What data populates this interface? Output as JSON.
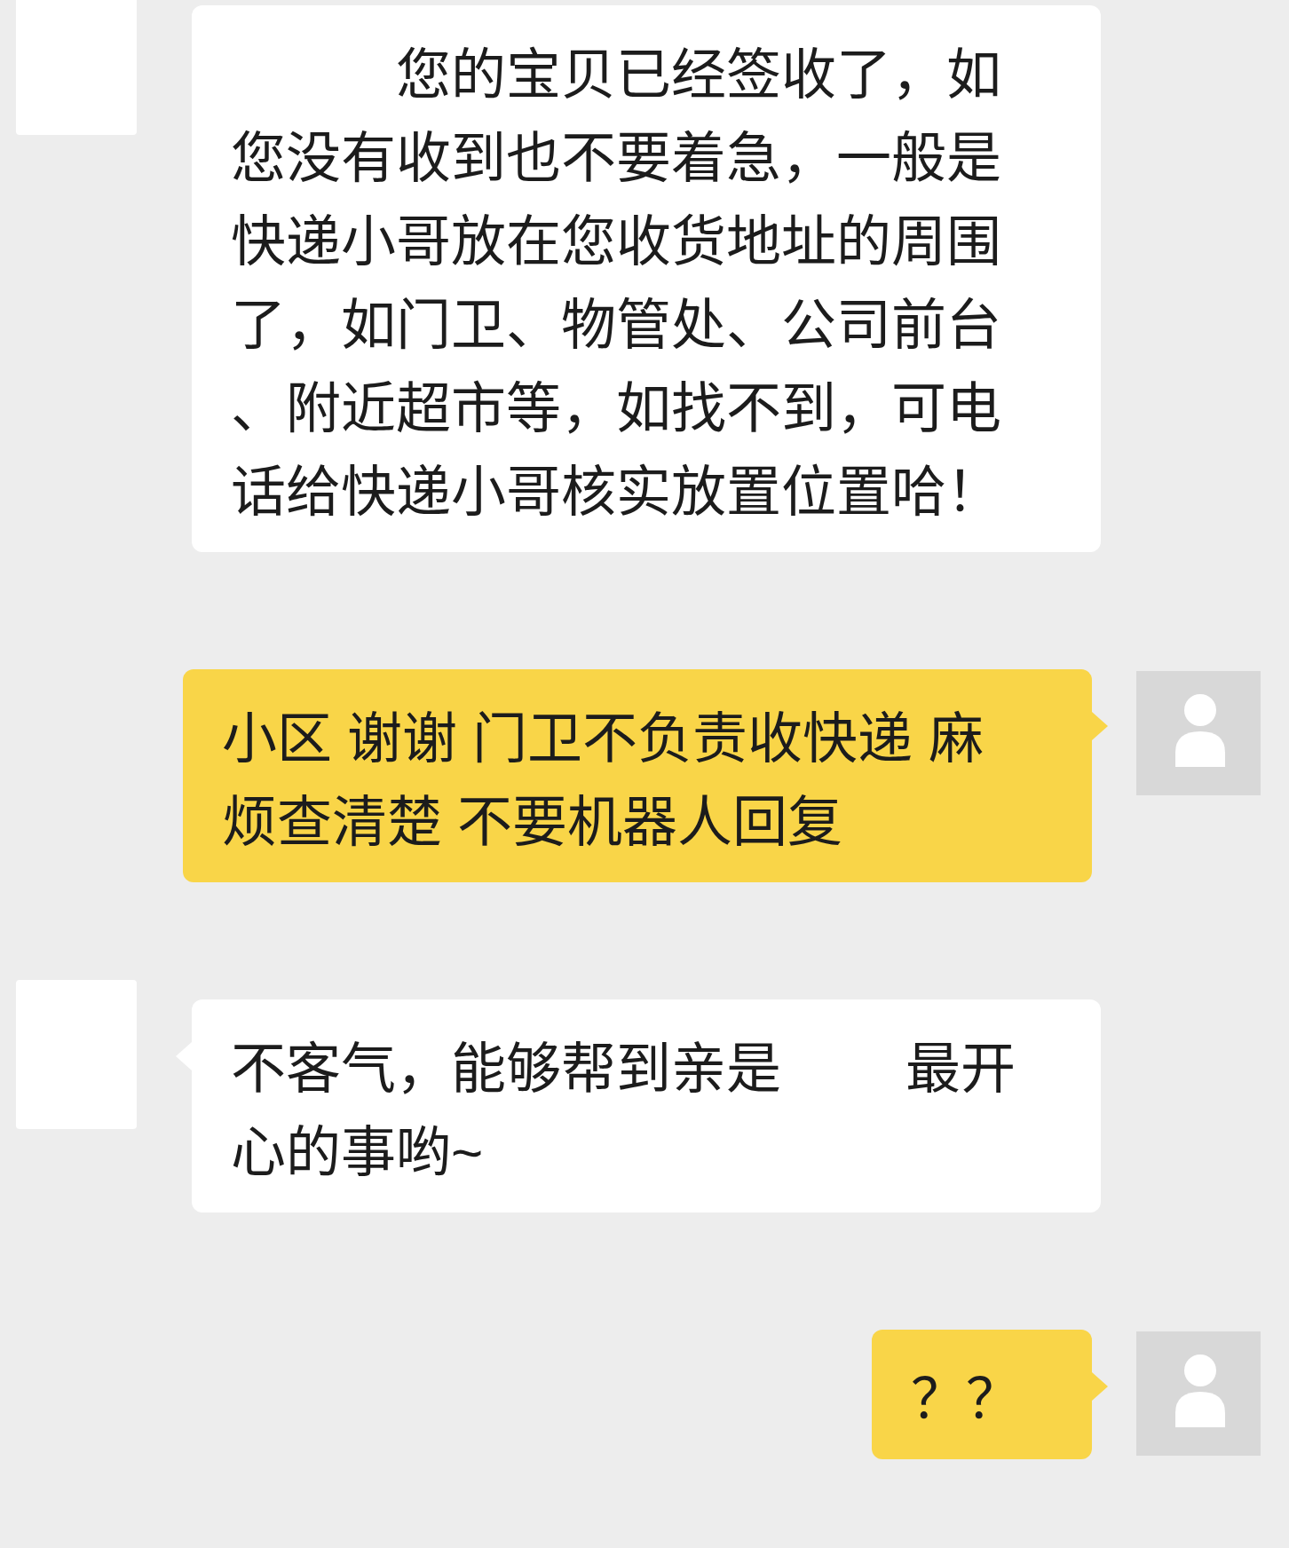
{
  "messages": [
    {
      "kind": "incoming",
      "tail": false,
      "segments": [
        {
          "kind": "redacted"
        },
        {
          "kind": "text",
          "text": "您的宝贝已经签收了，如您没有收到也不要着急，一般是快递小哥放在您收货地址的周围了，如门卫、物管处、公司前台、附近超市等，如找不到，可电话给快递小哥核实放置位置哈！"
        }
      ]
    },
    {
      "kind": "outgoing",
      "tail": true,
      "segments": [
        {
          "kind": "text",
          "text": "小区 谢谢 门卫不负责收快递 麻烦查清楚 不要机器人回复"
        }
      ]
    },
    {
      "kind": "incoming",
      "tail": true,
      "segments": [
        {
          "kind": "text",
          "text": "不客气，能够帮到亲是"
        },
        {
          "kind": "redacted"
        },
        {
          "kind": "text",
          "text": "最开心的事哟~"
        }
      ]
    },
    {
      "kind": "outgoing",
      "tail": true,
      "segments": [
        {
          "kind": "text",
          "text": "？？"
        }
      ]
    }
  ]
}
